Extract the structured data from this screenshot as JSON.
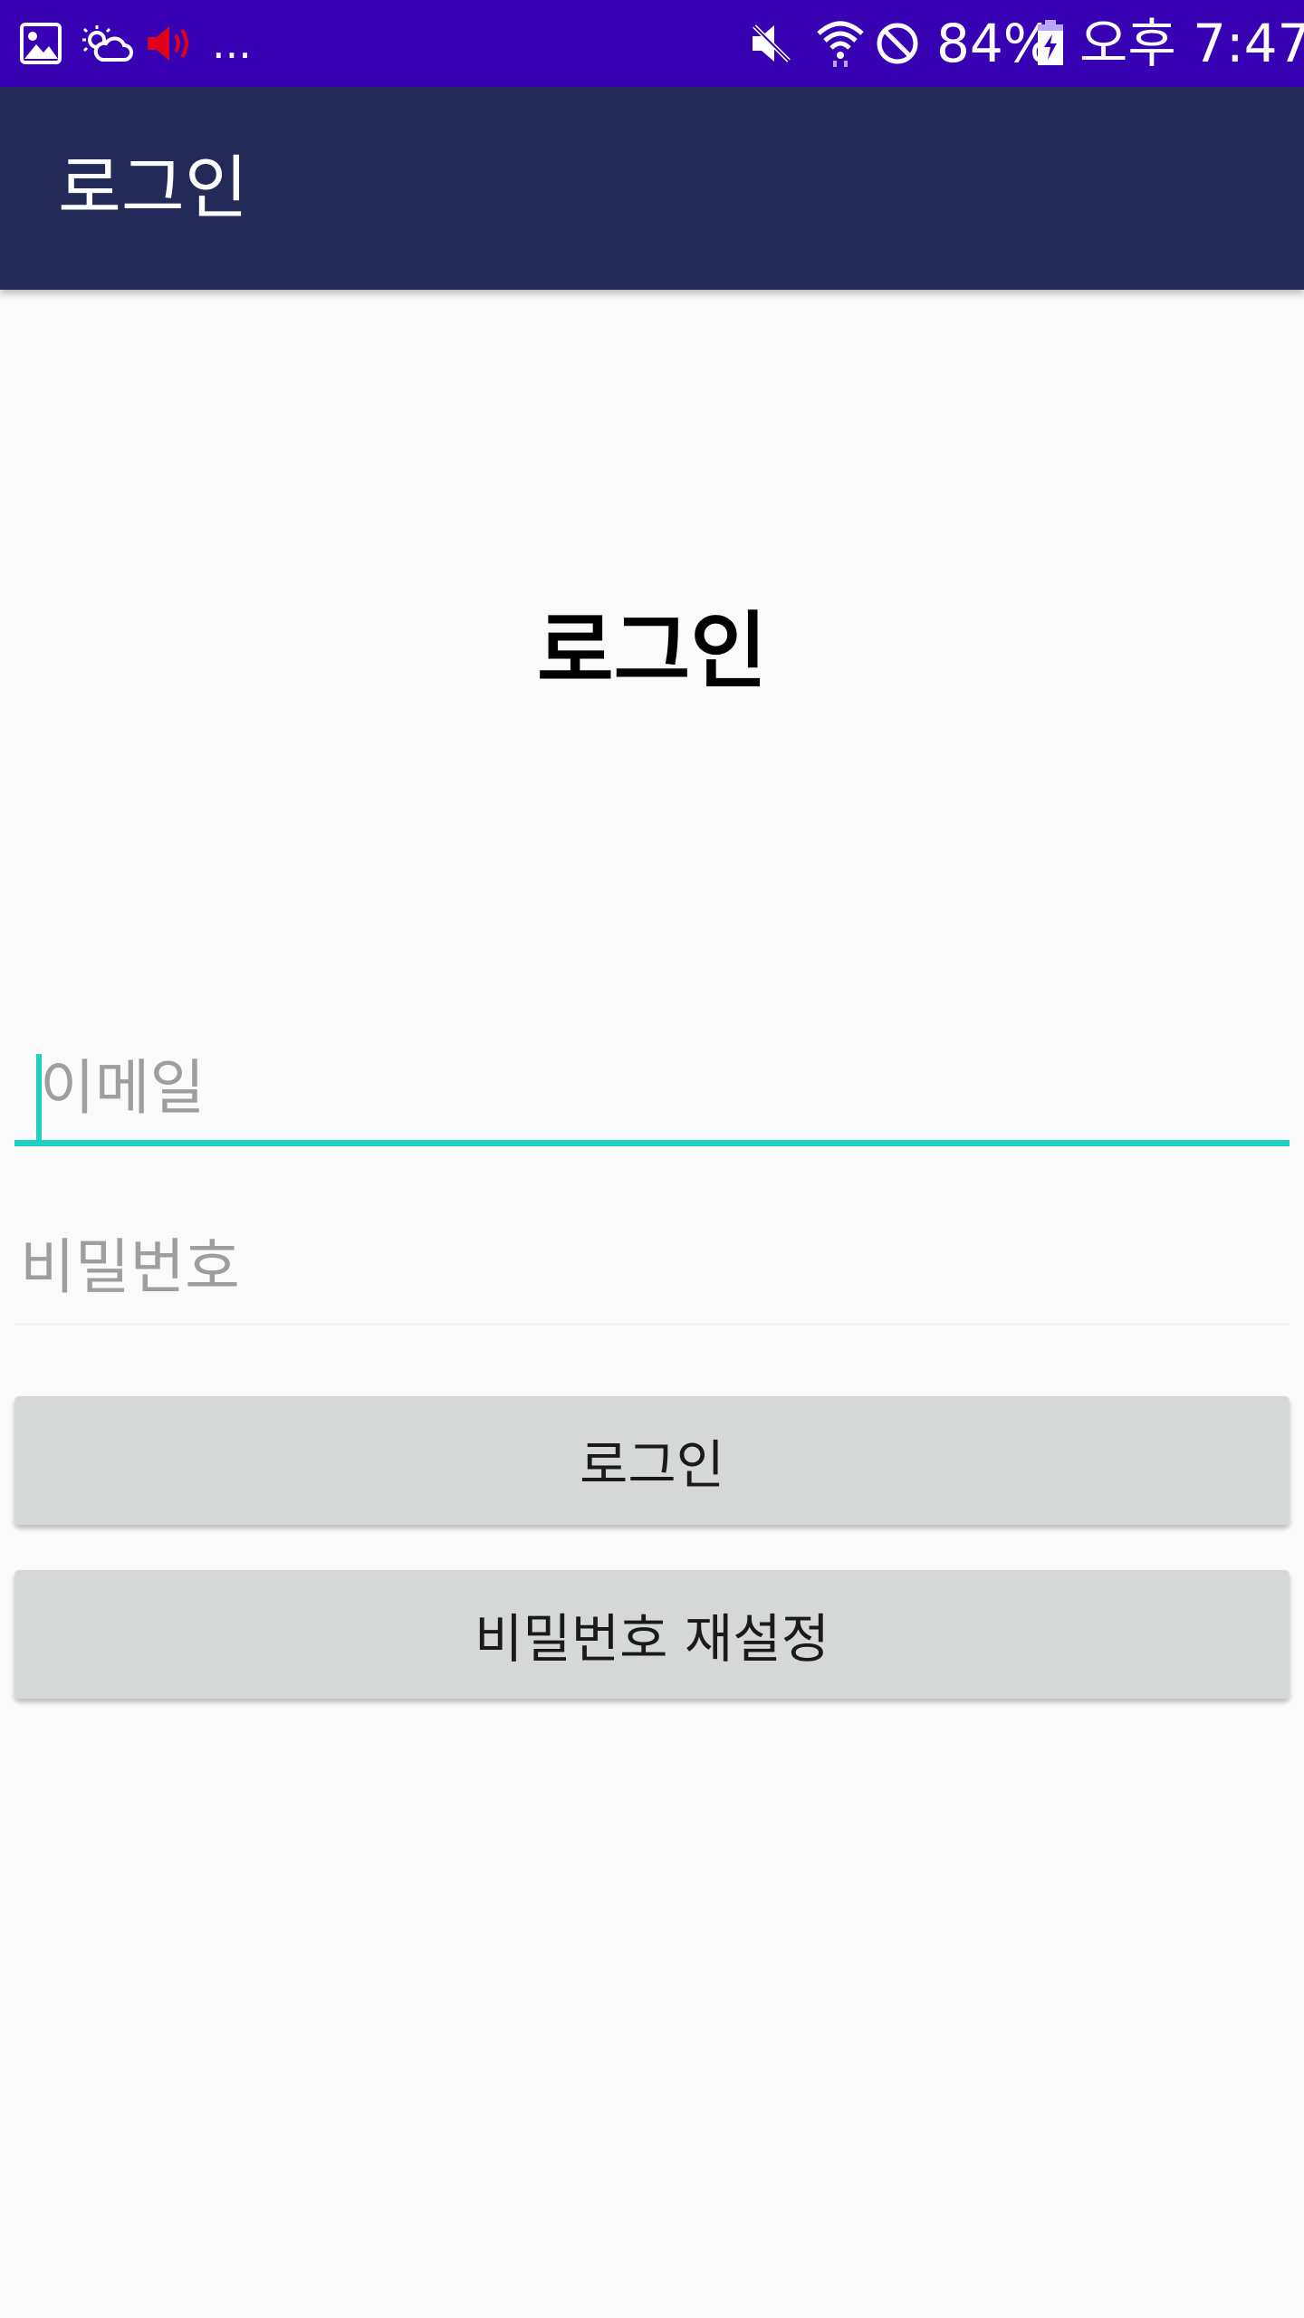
{
  "status_bar": {
    "left_icons": [
      "image-icon",
      "weather-icon",
      "speaker-icon",
      "more-dots"
    ],
    "more_text": "...",
    "right_icons": [
      "mute-icon",
      "wifi-icon",
      "block-icon",
      "battery-icon"
    ],
    "battery": "84%",
    "time": "오후 7:47",
    "colors": {
      "background": "#3700b3",
      "speaker_icon": "#e0001a"
    }
  },
  "app_bar": {
    "title": "로그인",
    "background": "#242a58"
  },
  "main": {
    "heading": "로그인",
    "email_field": {
      "placeholder": "이메일",
      "value": "",
      "focused": true
    },
    "password_field": {
      "placeholder": "비밀번호",
      "value": ""
    },
    "login_button": "로그인",
    "reset_password_button": "비밀번호 재설정",
    "colors": {
      "accent": "#1fd0c2",
      "button_bg": "#d6d7d7",
      "background": "#fafafa"
    }
  }
}
